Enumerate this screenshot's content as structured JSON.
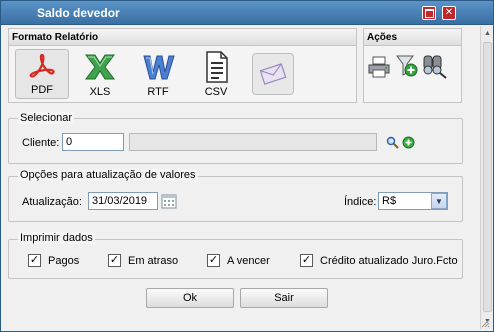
{
  "window": {
    "title": "Saldo devedor"
  },
  "formato": {
    "title": "Formato Relatório",
    "items": [
      {
        "label": "PDF",
        "icon": "pdf-icon"
      },
      {
        "label": "XLS",
        "icon": "excel-icon"
      },
      {
        "label": "RTF",
        "icon": "word-icon"
      },
      {
        "label": "CSV",
        "icon": "csv-document-icon"
      },
      {
        "label": "",
        "icon": "email-envelope-icon"
      }
    ]
  },
  "acoes": {
    "title": "Ações",
    "icons": [
      "printer-icon",
      "filter-add-icon",
      "binoculars-search-icon"
    ]
  },
  "selecionar": {
    "legend": "Selecionar",
    "cliente_label": "Cliente:",
    "cliente_value": "0",
    "cliente_name_value": ""
  },
  "opcoes": {
    "legend": "Opções para atualização de valores",
    "atualizacao_label": "Atualização:",
    "atualizacao_value": "31/03/2019",
    "indice_label": "Índice:",
    "indice_value": "R$"
  },
  "imprimir": {
    "legend": "Imprimir dados",
    "checks": [
      {
        "label": "Pagos",
        "checked": true
      },
      {
        "label": "Em atraso",
        "checked": true
      },
      {
        "label": "A vencer",
        "checked": true
      },
      {
        "label": "Crédito atualizado Juro.Fcto",
        "checked": true
      }
    ]
  },
  "buttons": {
    "ok": "Ok",
    "sair": "Sair"
  },
  "colors": {
    "title_bar": "#3a6fa3",
    "close": "#c0282b",
    "pdf_red": "#d42a22",
    "excel_green": "#2e8b3e",
    "word_blue": "#3b6fc4"
  }
}
